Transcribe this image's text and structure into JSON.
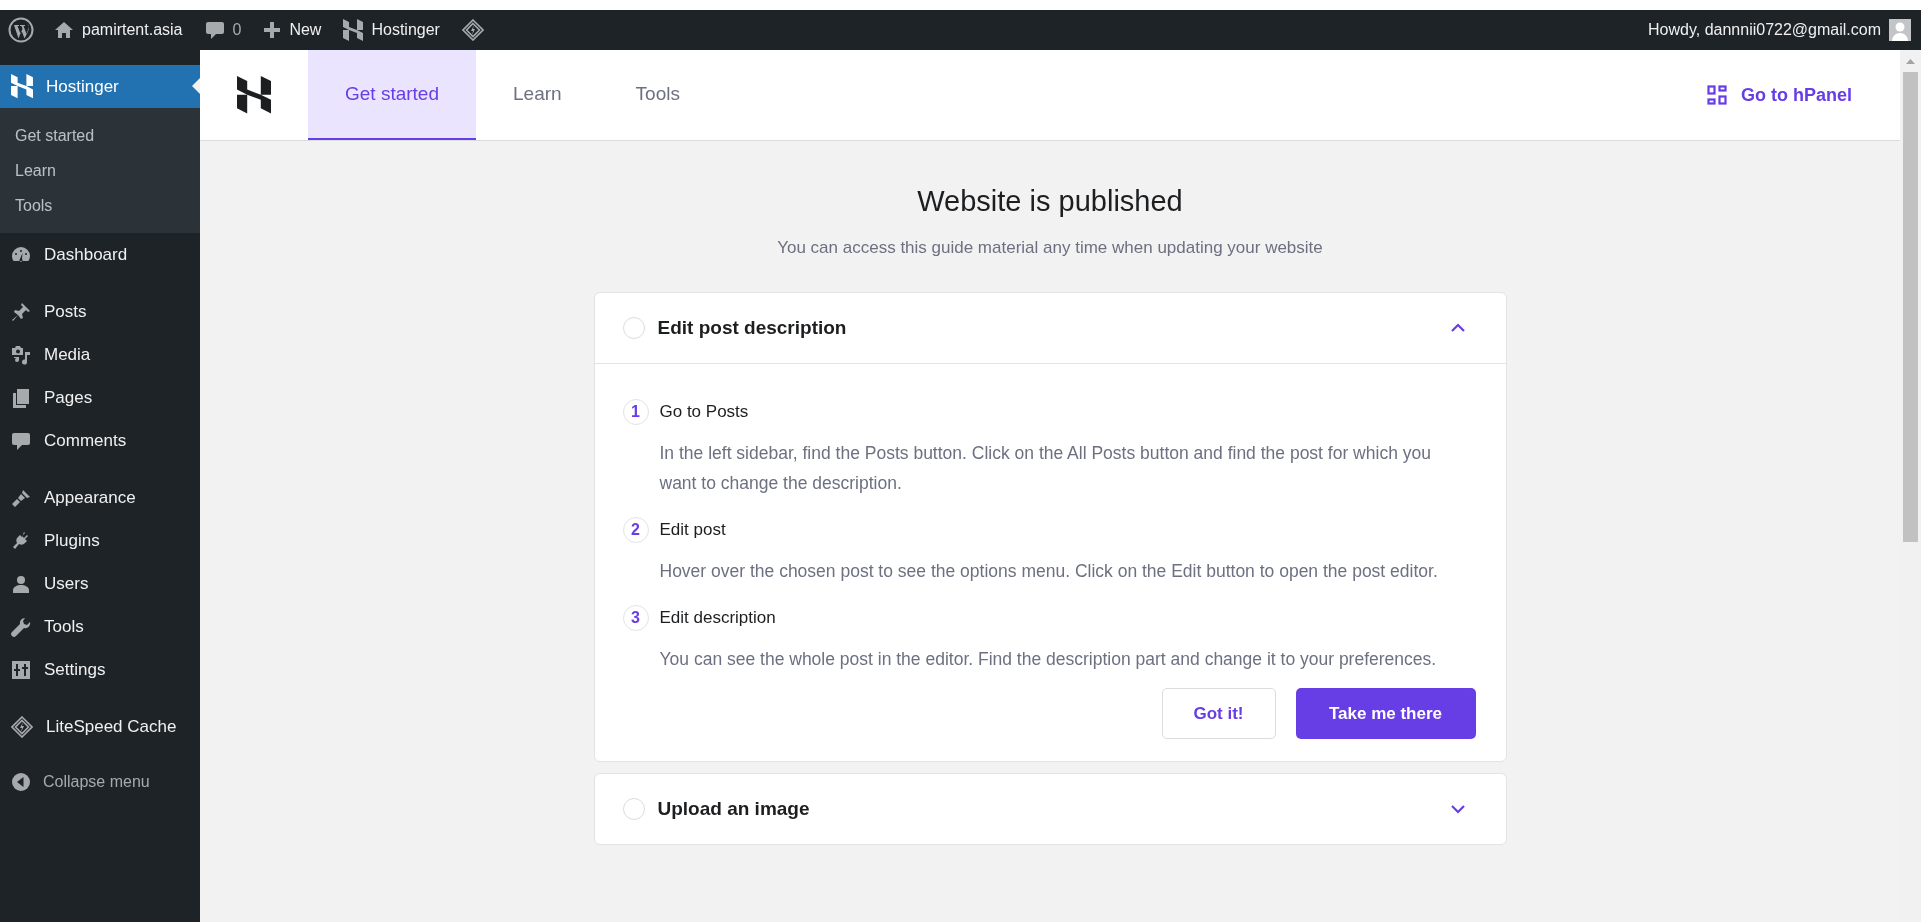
{
  "admin_bar": {
    "site_name": "pamirtent.asia",
    "comments_count": "0",
    "new_label": "New",
    "plugin_label": "Hostinger",
    "greeting": "Howdy, dannnii0722@gmail.com"
  },
  "sidebar": {
    "groups": [
      {
        "items": [
          {
            "label": "Hostinger",
            "selected": true,
            "children": [
              {
                "label": "Get started",
                "selected": false
              },
              {
                "label": "Learn",
                "selected": false
              },
              {
                "label": "Tools",
                "selected": false
              }
            ]
          },
          {
            "label": "Dashboard",
            "selected": false
          }
        ]
      },
      {
        "items": [
          {
            "label": "Posts",
            "selected": false
          },
          {
            "label": "Media",
            "selected": false
          },
          {
            "label": "Pages",
            "selected": false
          },
          {
            "label": "Comments",
            "selected": false
          }
        ]
      },
      {
        "items": [
          {
            "label": "Appearance",
            "selected": false
          },
          {
            "label": "Plugins",
            "selected": false
          },
          {
            "label": "Users",
            "selected": false
          },
          {
            "label": "Tools",
            "selected": false
          },
          {
            "label": "Settings",
            "selected": false
          }
        ]
      },
      {
        "items": [
          {
            "label": "LiteSpeed Cache",
            "selected": false
          }
        ]
      }
    ],
    "collapse_label": "Collapse menu"
  },
  "header": {
    "tabs": [
      {
        "label": "Get started",
        "selected": true
      },
      {
        "label": "Learn",
        "selected": false
      },
      {
        "label": "Tools",
        "selected": false
      }
    ],
    "hpanel_link": "Go to hPanel"
  },
  "guide": {
    "title": "Website is published",
    "subtitle": "You can access this guide material any time when updating your website",
    "tasks": [
      {
        "title": "Edit post description",
        "done": false,
        "expanded": true,
        "steps": [
          {
            "number": "1",
            "title": "Go to Posts",
            "text": "In the left sidebar, find the Posts button. Click on the All Posts button and find the post for which you want to change the description."
          },
          {
            "number": "2",
            "title": "Edit post",
            "text": "Hover over the chosen post to see the options menu. Click on the Edit button to open the post editor."
          },
          {
            "number": "3",
            "title": "Edit description",
            "text": "You can see the whole post in the editor. Find the description part and change it to your preferences."
          }
        ],
        "secondary_button": "Got it!",
        "primary_button": "Take me there"
      },
      {
        "title": "Upload an image",
        "done": false,
        "expanded": false
      }
    ]
  }
}
